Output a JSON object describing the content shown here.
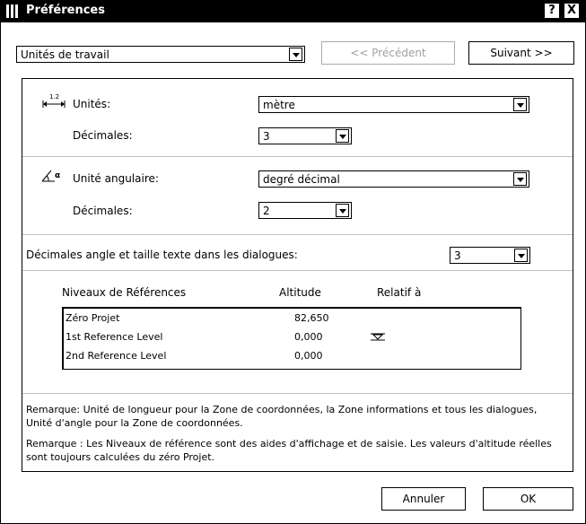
{
  "window": {
    "title": "Préférences",
    "help_label": "?",
    "close_label": "X"
  },
  "nav": {
    "category": "Unités de travail",
    "prev_label": "<< Précédent",
    "next_label": "Suivant >>"
  },
  "units": {
    "icon_text": "1.2",
    "label": "Unités:",
    "value": "mètre",
    "decimals_label": "Décimales:",
    "decimals_value": "3"
  },
  "angular": {
    "icon_text": "α",
    "label": "Unité angulaire:",
    "value": "degré décimal",
    "decimals_label": "Décimales:",
    "decimals_value": "2"
  },
  "dialog_decimals": {
    "label": "Décimales angle et taille texte dans les dialogues:",
    "value": "3"
  },
  "levels": {
    "headers": [
      "Niveaux de Références",
      "Altitude",
      "Relatif à"
    ],
    "rows": [
      {
        "name": "Zéro Projet",
        "altitude": "82,650"
      },
      {
        "name": "1st Reference Level",
        "altitude": "0,000"
      },
      {
        "name": "2nd Reference Level",
        "altitude": "0,000"
      }
    ]
  },
  "notes": [
    "Remarque: Unité de longueur pour la Zone de coordonnées, la Zone informations et tous les dialogues, Unité d'angle pour la Zone de coordonnées.",
    "Remarque : Les Niveaux de référence sont des aides d'affichage et de saisie. Les valeurs d'altitude réelles sont toujours calculées du zéro Projet."
  ],
  "footer": {
    "cancel_label": "Annuler",
    "ok_label": "OK"
  }
}
